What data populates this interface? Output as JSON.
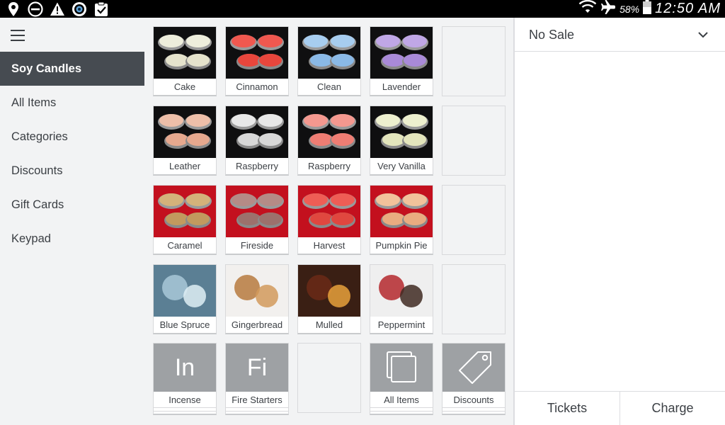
{
  "status_bar": {
    "icons": [
      "location-icon",
      "dnd-icon",
      "warning-icon",
      "camera-icon",
      "clipboard-check-icon"
    ],
    "battery_pct": "58%",
    "time": "12:50 AM"
  },
  "sidebar": {
    "items": [
      {
        "label": "Soy Candles",
        "active": true
      },
      {
        "label": "All Items",
        "active": false
      },
      {
        "label": "Categories",
        "active": false
      },
      {
        "label": "Discounts",
        "active": false
      },
      {
        "label": "Gift Cards",
        "active": false
      },
      {
        "label": "Keypad",
        "active": false
      }
    ]
  },
  "grid": {
    "rows": [
      [
        {
          "label": "Cake",
          "bg": "#0f0f10",
          "c1": "#eeeedc",
          "c2": "#e5e3cc"
        },
        {
          "label": "Cinnamon",
          "bg": "#0f0f10",
          "c1": "#f0584f",
          "c2": "#e8463c"
        },
        {
          "label": "Clean",
          "bg": "#0f0f10",
          "c1": "#a7cdef",
          "c2": "#8ab9e6"
        },
        {
          "label": "Lavender",
          "bg": "#0f0f10",
          "c1": "#c0a7e6",
          "c2": "#a98ad8"
        },
        null
      ],
      [
        {
          "label": "Leather",
          "bg": "#0f0f10",
          "c1": "#eebfa9",
          "c2": "#e6a88e"
        },
        {
          "label": "Raspberry",
          "bg": "#0f0f10",
          "c1": "#e8e8e8",
          "c2": "#d8d8d8"
        },
        {
          "label": "Raspberry",
          "bg": "#0f0f10",
          "c1": "#f4988f",
          "c2": "#ef7d73"
        },
        {
          "label": "Very Vanilla",
          "bg": "#0f0f10",
          "c1": "#eef0cf",
          "c2": "#e3e5bc"
        },
        null
      ],
      [
        {
          "label": "Caramel",
          "bg": "#c3101e",
          "c1": "#d4b27a",
          "c2": "#c29a5e"
        },
        {
          "label": "Fireside",
          "bg": "#c3101e",
          "c1": "#b58b86",
          "c2": "#9c716c"
        },
        {
          "label": "Harvest",
          "bg": "#c3101e",
          "c1": "#ef5d55",
          "c2": "#e0473f"
        },
        {
          "label": "Pumpkin Pie",
          "bg": "#c3101e",
          "c1": "#f2c29b",
          "c2": "#e9ac80"
        },
        null
      ],
      [
        {
          "label": "Blue Spruce",
          "bg": "#5b7f94",
          "c1": "#a9c8d8",
          "c2": "#dfeef5"
        },
        {
          "label": "Gingerbread",
          "bg": "#f2f0ee",
          "c1": "#b77a3e",
          "c2": "#d29a5c"
        },
        {
          "label": "Mulled",
          "bg": "#3a1f14",
          "c1": "#6b2a16",
          "c2": "#e7a13b"
        },
        {
          "label": "Peppermint",
          "bg": "#efefef",
          "c1": "#b4282d",
          "c2": "#3f2a22"
        },
        null
      ]
    ],
    "bottom_row": [
      {
        "type": "text",
        "abbr": "In",
        "label": "Incense"
      },
      {
        "type": "text",
        "abbr": "Fi",
        "label": "Fire Starters"
      },
      {
        "type": "empty"
      },
      {
        "type": "icon",
        "icon": "stacked-squares-icon",
        "label": "All Items"
      },
      {
        "type": "icon",
        "icon": "tag-icon",
        "label": "Discounts"
      }
    ]
  },
  "ticket": {
    "title": "No Sale",
    "tickets_label": "Tickets",
    "charge_label": "Charge"
  }
}
